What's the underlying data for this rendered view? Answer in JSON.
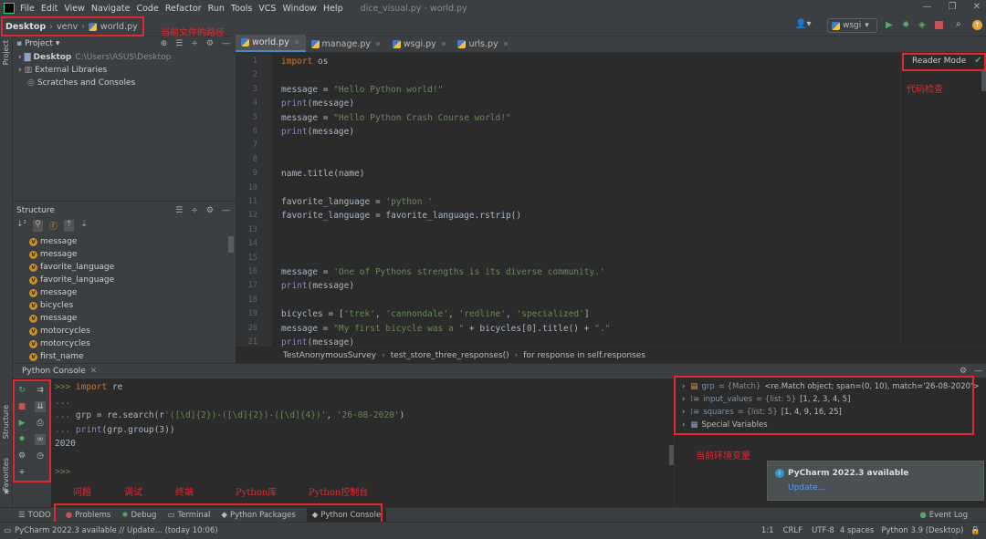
{
  "menu": [
    "File",
    "Edit",
    "View",
    "Navigate",
    "Code",
    "Refactor",
    "Run",
    "Tools",
    "VCS",
    "Window",
    "Help"
  ],
  "window_title": "dice_visual.py - world.py",
  "breadcrumb": {
    "root": "Desktop",
    "folder": "venv",
    "file": "world.py"
  },
  "annotations": {
    "file_path": "当前文件的路径",
    "code_check": "代码检查",
    "env_vars": "当前环境变量",
    "problems": "问题",
    "debug": "调试",
    "terminal": "终端",
    "packages": "Python库",
    "console": "Python控制台"
  },
  "run_config": "wsgi",
  "project": {
    "title": "Project",
    "items": [
      {
        "name": "Desktop",
        "path": "C:\\Users\\ASUS\\Desktop"
      },
      {
        "name": "External Libraries"
      },
      {
        "name": "Scratches and Consoles"
      }
    ]
  },
  "structure": {
    "title": "Structure",
    "items": [
      "message",
      "message",
      "favorite_language",
      "favorite_language",
      "message",
      "bicycles",
      "message",
      "motorcycles",
      "motorcycles",
      "first_name"
    ]
  },
  "tabs": [
    "world.py",
    "manage.py",
    "wsgi.py",
    "urls.py"
  ],
  "reader_mode": "Reader Mode",
  "editor": {
    "lines": [
      {
        "n": "1",
        "code": "import os",
        "t": "import"
      },
      {
        "n": "2",
        "code": ""
      },
      {
        "n": "3",
        "code": "message = \"Hello Python world!\"",
        "t": "assign"
      },
      {
        "n": "4",
        "code": "print(message)",
        "t": "print"
      },
      {
        "n": "5",
        "code": "message = \"Hello Python Crash Course world!\"",
        "t": "assign"
      },
      {
        "n": "6",
        "code": "print(message)",
        "t": "print"
      },
      {
        "n": "7",
        "code": ""
      },
      {
        "n": "8",
        "code": ""
      },
      {
        "n": "9",
        "code": "name.title(name)"
      },
      {
        "n": "10",
        "code": ""
      },
      {
        "n": "11",
        "code": "favorite_language = 'python '",
        "t": "assign"
      },
      {
        "n": "12",
        "code": "favorite_language = favorite_language.rstrip()"
      },
      {
        "n": "13",
        "code": ""
      },
      {
        "n": "14",
        "code": ""
      },
      {
        "n": "15",
        "code": ""
      },
      {
        "n": "16",
        "code": "message = 'One of Pythons strengths is its diverse community.'",
        "t": "assign"
      },
      {
        "n": "17",
        "code": "print(message)",
        "t": "print"
      },
      {
        "n": "18",
        "code": ""
      },
      {
        "n": "19",
        "code": "bicycles = ['trek', 'cannondale', 'redline', 'specialized']",
        "t": "assign"
      },
      {
        "n": "20",
        "code": "message = \"My first bicycle was a \" + bicycles[0].title() + \".\"",
        "t": "assign"
      },
      {
        "n": "21",
        "code": "print(message)",
        "t": "print"
      }
    ]
  },
  "code_breadcrumb": [
    "TestAnonymousSurvey",
    "test_store_three_responses()",
    "for response in self.responses"
  ],
  "console": {
    "title": "Python Console",
    "lines": [
      ">>> import re",
      "...",
      "... grp = re.search(r'([\\d]{2})-([\\d]{2})-([\\d]{4})', '26-08-2020')",
      "... print(grp.group(3))",
      "2020",
      "",
      ">>>"
    ]
  },
  "variables": [
    {
      "name": "grp",
      "type": "{Match}",
      "value": "<re.Match object; span=(0, 10), match='26-08-2020'>"
    },
    {
      "name": "input_values",
      "type": "{list: 5}",
      "value": "[1, 2, 3, 4, 5]"
    },
    {
      "name": "squares",
      "type": "{list: 5}",
      "value": "[1, 4, 9, 16, 25]"
    },
    {
      "name": "Special Variables",
      "type": "",
      "value": ""
    }
  ],
  "notification": {
    "title": "PyCharm 2022.3 available",
    "link": "Update..."
  },
  "tool_windows": [
    "TODO",
    "Problems",
    "Debug",
    "Terminal",
    "Python Packages",
    "Python Console"
  ],
  "event_log": "Event Log",
  "status": {
    "message": "PyCharm 2022.3 available // Update... (today 10:06)",
    "pos": "1:1",
    "eol": "CRLF",
    "enc": "UTF-8",
    "indent": "4 spaces",
    "interp": "Python 3.9 (Desktop)"
  },
  "side_labels": {
    "project": "Project",
    "structure": "Structure",
    "favorites": "Favorites"
  }
}
